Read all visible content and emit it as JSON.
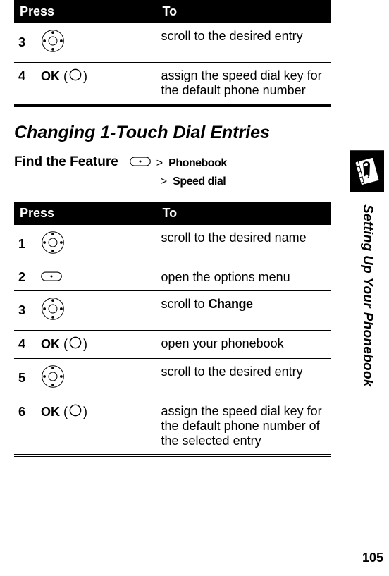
{
  "table1": {
    "headers": {
      "press": "Press",
      "to": "To"
    },
    "rows": [
      {
        "step": "3",
        "to": "scroll to the desired entry",
        "icon": "dpad"
      },
      {
        "step": "4",
        "ok": "OK",
        "to": "assign the speed dial key for the default phone number",
        "icon": "ok"
      }
    ]
  },
  "heading": "Changing 1-Touch Dial Entries",
  "feature": {
    "label": "Find the Feature",
    "gt": ">",
    "item1": "Phonebook",
    "item2": "Speed dial"
  },
  "table2": {
    "headers": {
      "press": "Press",
      "to": "To"
    },
    "rows": [
      {
        "step": "1",
        "to": "scroll to the desired name",
        "icon": "dpad"
      },
      {
        "step": "2",
        "to": "open the options menu",
        "icon": "softkey"
      },
      {
        "step": "3",
        "to_prefix": "scroll to ",
        "to_bold": "Change",
        "icon": "dpad"
      },
      {
        "step": "4",
        "ok": "OK",
        "to": "open your phonebook",
        "icon": "ok"
      },
      {
        "step": "5",
        "to": "scroll to the desired entry",
        "icon": "dpad"
      },
      {
        "step": "6",
        "ok": "OK",
        "to": "assign the speed dial key for the default phone number of the selected entry",
        "icon": "ok"
      }
    ]
  },
  "side_label": "Setting Up Your Phonebook",
  "page_number": "105"
}
